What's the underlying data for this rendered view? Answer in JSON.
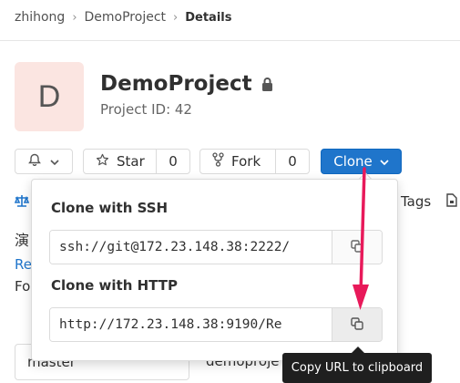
{
  "breadcrumb": {
    "items": [
      "zhihong",
      "DemoProject"
    ],
    "current": "Details"
  },
  "project": {
    "avatar_letter": "D",
    "name": "DemoProject",
    "id_text": "Project ID: 42"
  },
  "actions": {
    "star_label": "Star",
    "star_count": "0",
    "fork_label": "Fork",
    "fork_count": "0",
    "clone_label": "Clone"
  },
  "background": {
    "tags_label": "Tags",
    "line1": "演",
    "line2": "Re",
    "line3": "Fo",
    "branch": "master",
    "path": "demoproje"
  },
  "clone_dropdown": {
    "ssh_heading": "Clone with SSH",
    "ssh_url": "ssh://git@172.23.148.38:2222/",
    "http_heading": "Clone with HTTP",
    "http_url": "http://172.23.148.38:9190/Re"
  },
  "tooltip": {
    "text": "Copy URL to clipboard"
  },
  "colors": {
    "primary": "#1f75cb",
    "annotation": "#e8195a",
    "avatar_bg": "#fbe5e1"
  },
  "icons": [
    "chevron-right-icon",
    "lock-icon",
    "bell-icon",
    "chevron-down-icon",
    "star-icon",
    "fork-icon",
    "copy-icon",
    "scale-icon",
    "file-icon"
  ]
}
